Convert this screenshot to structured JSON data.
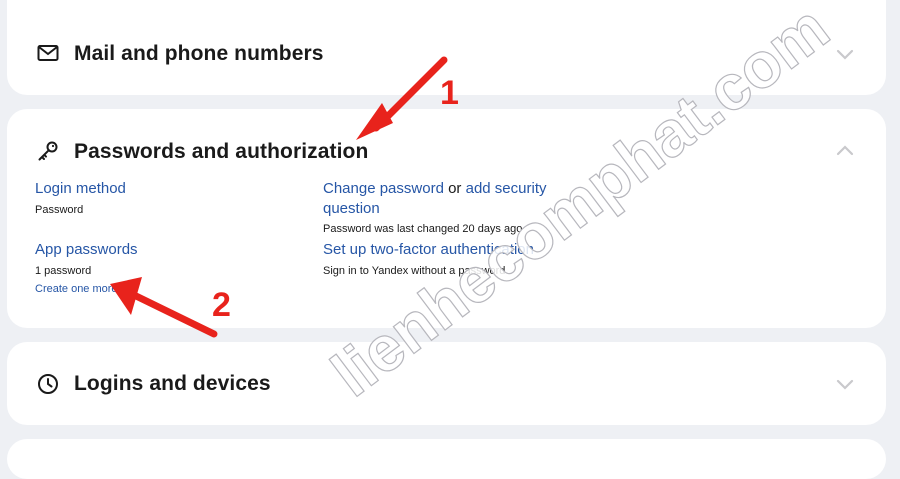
{
  "sections": {
    "mail": {
      "title": "Mail and phone numbers",
      "icon": "mail-icon"
    },
    "passwords": {
      "title": "Passwords and authorization",
      "icon": "key-icon",
      "login_method": {
        "label": "Login method",
        "value": "Password"
      },
      "change_password": {
        "link": "Change password",
        "connector": "or",
        "security_link_line1": "add security",
        "security_link_line2": "question",
        "subtext": "Password was last changed 20 days ago"
      },
      "app_passwords": {
        "label": "App passwords",
        "count": "1 password",
        "create_link": "Create one more"
      },
      "two_factor": {
        "link": "Set up two-factor authentication",
        "subtext": "Sign in to Yandex without a password"
      }
    },
    "logins": {
      "title": "Logins and devices",
      "icon": "clock-icon"
    }
  },
  "annotations": {
    "arrow1_label": "1",
    "arrow2_label": "2",
    "watermark": "lienhecomphat.com",
    "arrow_color": "#e8231c"
  },
  "colors": {
    "link": "#2656a6",
    "background": "#eef0f4",
    "card": "#ffffff"
  }
}
